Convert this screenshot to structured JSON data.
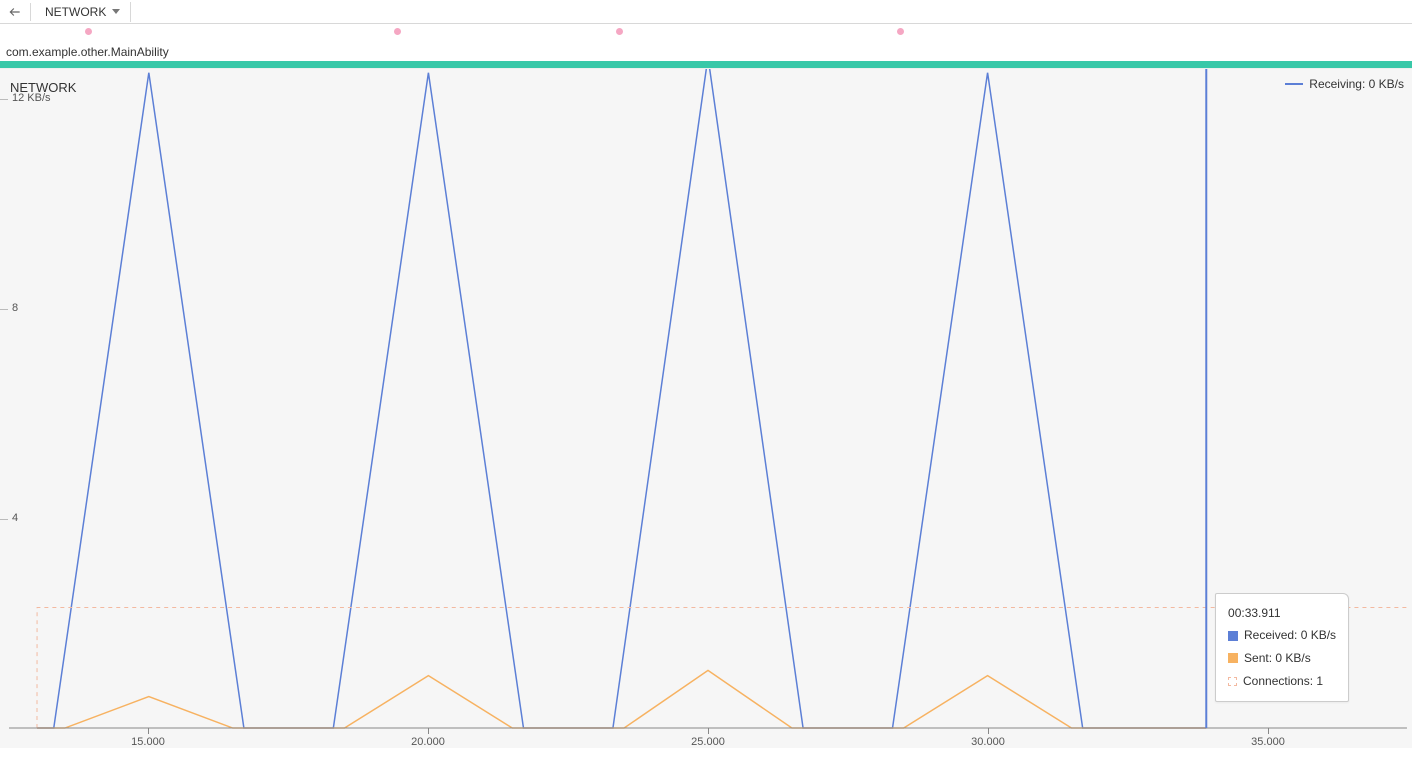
{
  "toolbar": {
    "back_icon": "back-arrow",
    "dropdown_label": "NETWORK"
  },
  "events": {
    "dot_positions_pct": [
      6.0,
      27.9,
      43.6,
      63.5
    ]
  },
  "ability": {
    "label": "com.example.other.MainAbility"
  },
  "chart": {
    "title": "NETWORK",
    "legend_top": "Receiving: 0 KB/s"
  },
  "tooltip": {
    "time": "00:33.911",
    "received": "Received: 0 KB/s",
    "sent": "Sent: 0 KB/s",
    "connections": "Connections: 1"
  },
  "chart_data": {
    "type": "line",
    "title": "NETWORK",
    "xlabel": "",
    "ylabel": "KB/s",
    "ylim": [
      0,
      12
    ],
    "xlim": [
      12.5,
      37.5
    ],
    "x_ticks": [
      15.0,
      20.0,
      25.0,
      30.0,
      35.0
    ],
    "x_tick_labels": [
      "15.000",
      "20.000",
      "25.000",
      "30.000",
      "35.000"
    ],
    "y_ticks": [
      4,
      8,
      12
    ],
    "y_tick_labels": [
      "4",
      "8",
      "12 KB/s"
    ],
    "series": [
      {
        "name": "Receiving",
        "color": "#5c7fd6",
        "x": [
          13.0,
          13.3,
          15.0,
          16.7,
          17.0,
          18.0,
          18.3,
          20.0,
          21.7,
          22.0,
          23.0,
          23.3,
          25.0,
          26.7,
          27.0,
          28.0,
          28.3,
          30.0,
          31.7,
          32.0,
          33.911
        ],
        "values": [
          0,
          0,
          12.5,
          0,
          0,
          0,
          0,
          12.5,
          0,
          0,
          0,
          0,
          12.8,
          0,
          0,
          0,
          0,
          12.5,
          0,
          0,
          0
        ]
      },
      {
        "name": "Sent",
        "color": "#f7b261",
        "x": [
          13.0,
          13.5,
          15.0,
          16.5,
          17.0,
          18.0,
          18.5,
          20.0,
          21.5,
          22.0,
          23.0,
          23.5,
          25.0,
          26.5,
          27.0,
          28.0,
          28.5,
          30.0,
          31.5,
          32.0,
          33.911
        ],
        "values": [
          0,
          0,
          0.6,
          0,
          0,
          0,
          0,
          1.0,
          0,
          0,
          0,
          0,
          1.1,
          0,
          0,
          0,
          0,
          1.0,
          0,
          0,
          0
        ]
      },
      {
        "name": "Connections",
        "color": "#f3b9a0",
        "style": "dashed",
        "x": [
          13.0,
          13.001,
          37.5
        ],
        "values": [
          0,
          2.3,
          2.3
        ]
      }
    ],
    "cursor_x": 33.911,
    "cursor_values": {
      "Received": "0 KB/s",
      "Sent": "0 KB/s",
      "Connections": 1
    }
  }
}
